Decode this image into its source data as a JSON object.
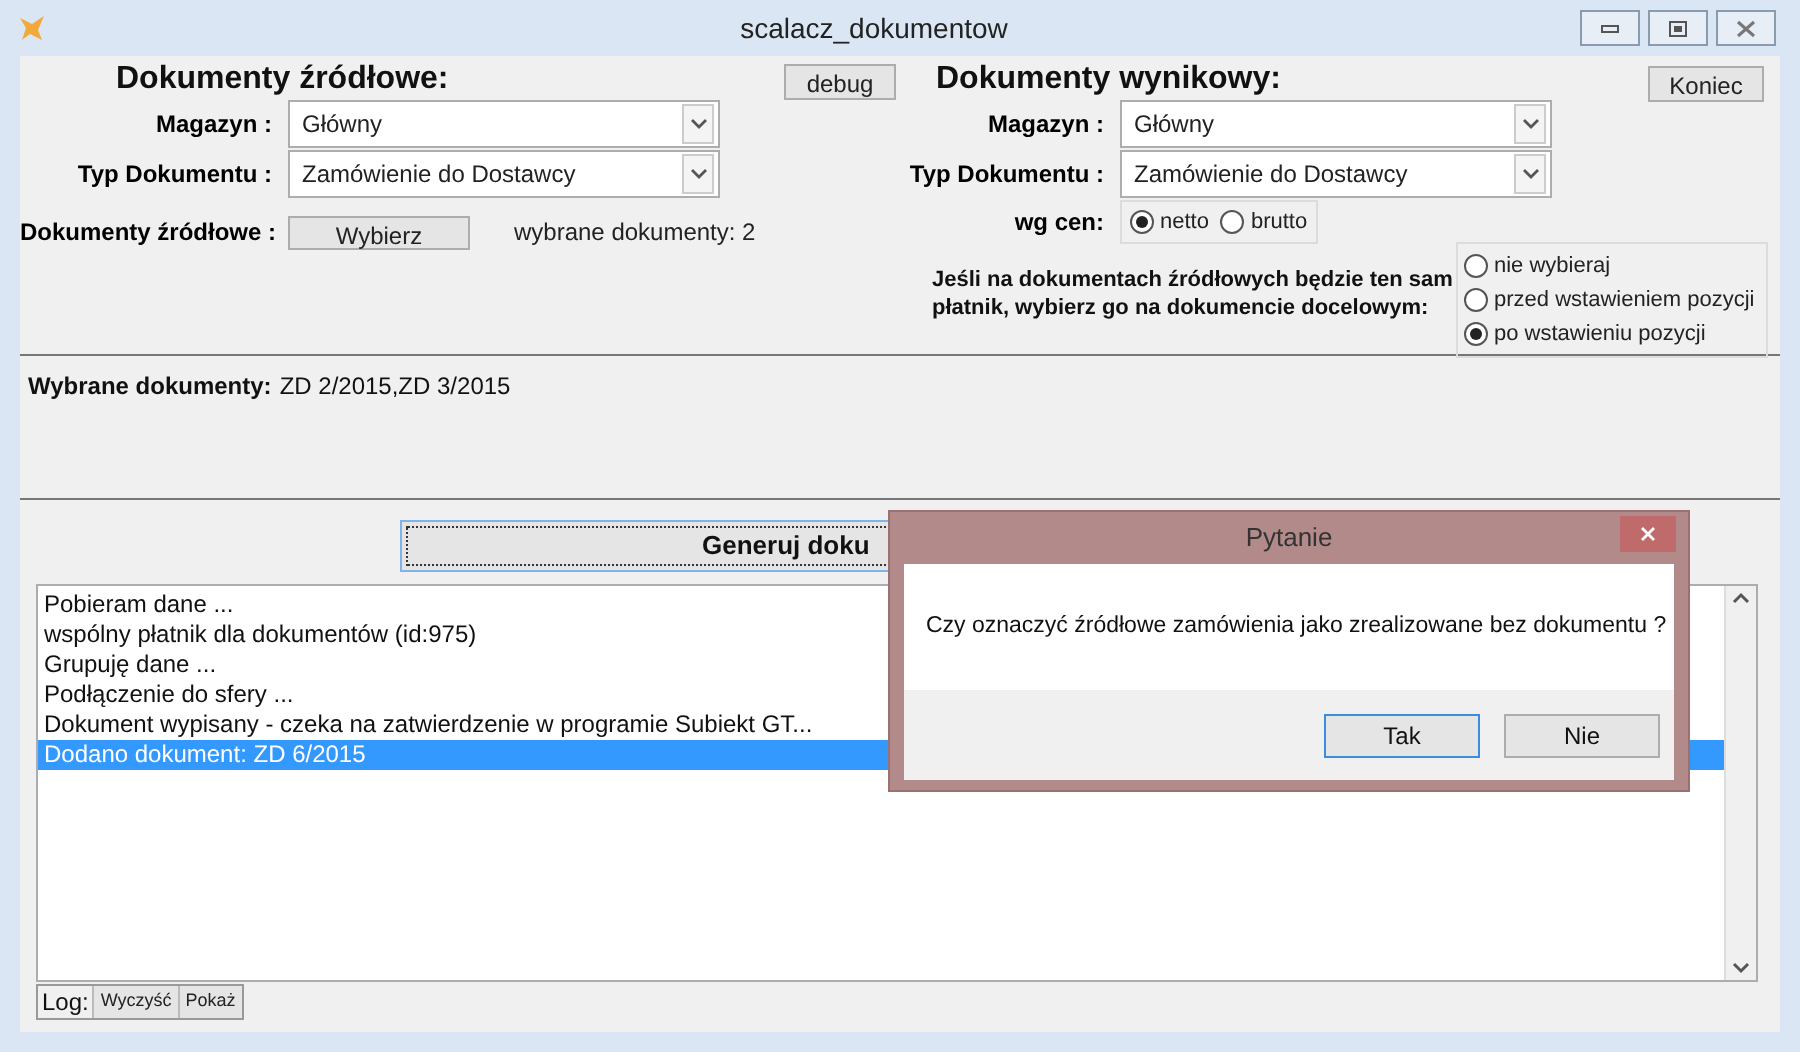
{
  "window": {
    "title": "scalacz_dokumentow"
  },
  "source": {
    "heading": "Dokumenty źródłowe:",
    "warehouse": {
      "label": "Magazyn :",
      "value": "Główny"
    },
    "doc_type": {
      "label": "Typ Dokumentu :",
      "value": "Zamówienie do Dostawcy"
    },
    "pick": {
      "label": "Dokumenty źródłowe :",
      "button": "Wybierz",
      "count": "wybrane dokumenty: 2"
    }
  },
  "debug_button": "debug",
  "target": {
    "heading": "Dokumenty wynikowy:",
    "warehouse": {
      "label": "Magazyn :",
      "value": "Główny"
    },
    "doc_type": {
      "label": "Typ Dokumentu :",
      "value": "Zamówienie do Dostawcy"
    },
    "price": {
      "label": "wg cen:",
      "options": [
        {
          "label": "netto",
          "selected": true
        },
        {
          "label": "brutto",
          "selected": false
        }
      ]
    },
    "payer": {
      "text": "Jeśli na dokumentach źródłowych będzie ten sam płatnik, wybierz go na dokumencie docelowym:",
      "options": [
        {
          "label": "nie wybieraj",
          "selected": false
        },
        {
          "label": "przed wstawieniem pozycji",
          "selected": false
        },
        {
          "label": "po wstawieniu pozycji",
          "selected": true
        }
      ]
    }
  },
  "end_button": "Koniec",
  "selected_docs": {
    "label": "Wybrane dokumenty:",
    "value": "ZD 2/2015,ZD 3/2015"
  },
  "generate_button": "Generuj doku",
  "log": {
    "lines": [
      {
        "text": "Pobieram dane ...",
        "selected": false
      },
      {
        "text": "wspólny płatnik dla dokumentów (id:975)",
        "selected": false
      },
      {
        "text": "Grupuję dane ...",
        "selected": false
      },
      {
        "text": "Podłączenie do sfery ...",
        "selected": false
      },
      {
        "text": "Dokument wypisany - czeka na zatwierdzenie w programie Subiekt GT...",
        "selected": false
      },
      {
        "text": "Dodano dokument: ZD 6/2015",
        "selected": true
      }
    ],
    "label": "Log:",
    "buttons": [
      "Wyczyść",
      "Pokaż"
    ]
  },
  "dialog": {
    "title": "Pytanie",
    "message": "Czy oznaczyć źródłowe zamówienia jako zrealizowane bez dokumentu ?",
    "buttons": [
      {
        "label": "Tak",
        "default": true
      },
      {
        "label": "Nie",
        "default": false
      }
    ]
  }
}
